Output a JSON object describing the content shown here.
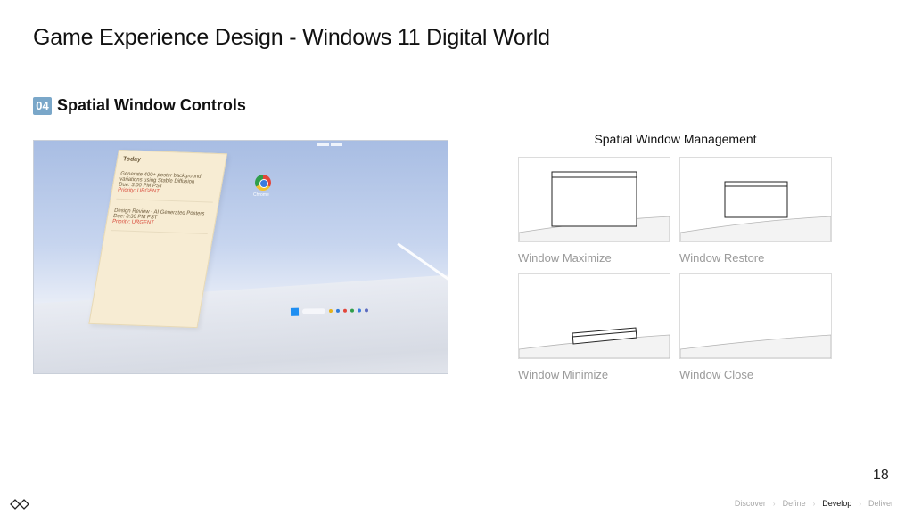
{
  "page": {
    "title": "Game Experience Design - Windows 11 Digital World",
    "number": "18"
  },
  "section": {
    "number": "04",
    "label": "Spatial Window Controls",
    "accent_color": "#7aa7c9"
  },
  "screenshot": {
    "panel_heading": "Today",
    "task1_title": "Generate 400+ poster background variations using Stable Diffusion",
    "task1_due": "Due: 3:00 PM PST",
    "task1_priority": "Priority: URGENT",
    "task2_title": "Design Review - AI Generated Posters",
    "task2_due": "Due: 3:30 PM PST",
    "task2_priority": "Priority: URGENT",
    "desktop_icon_label": "Chrome",
    "desktop_icon": "chrome-icon"
  },
  "diagram": {
    "title": "Spatial Window Management",
    "cells": [
      {
        "caption": "Window Maximize"
      },
      {
        "caption": "Window Restore"
      },
      {
        "caption": "Window Minimize"
      },
      {
        "caption": "Window Close"
      }
    ]
  },
  "footer": {
    "logo_icon": "double-diamond-icon",
    "nav": [
      "Discover",
      "Define",
      "Develop",
      "Deliver"
    ],
    "active": "Develop",
    "separator": "›"
  }
}
